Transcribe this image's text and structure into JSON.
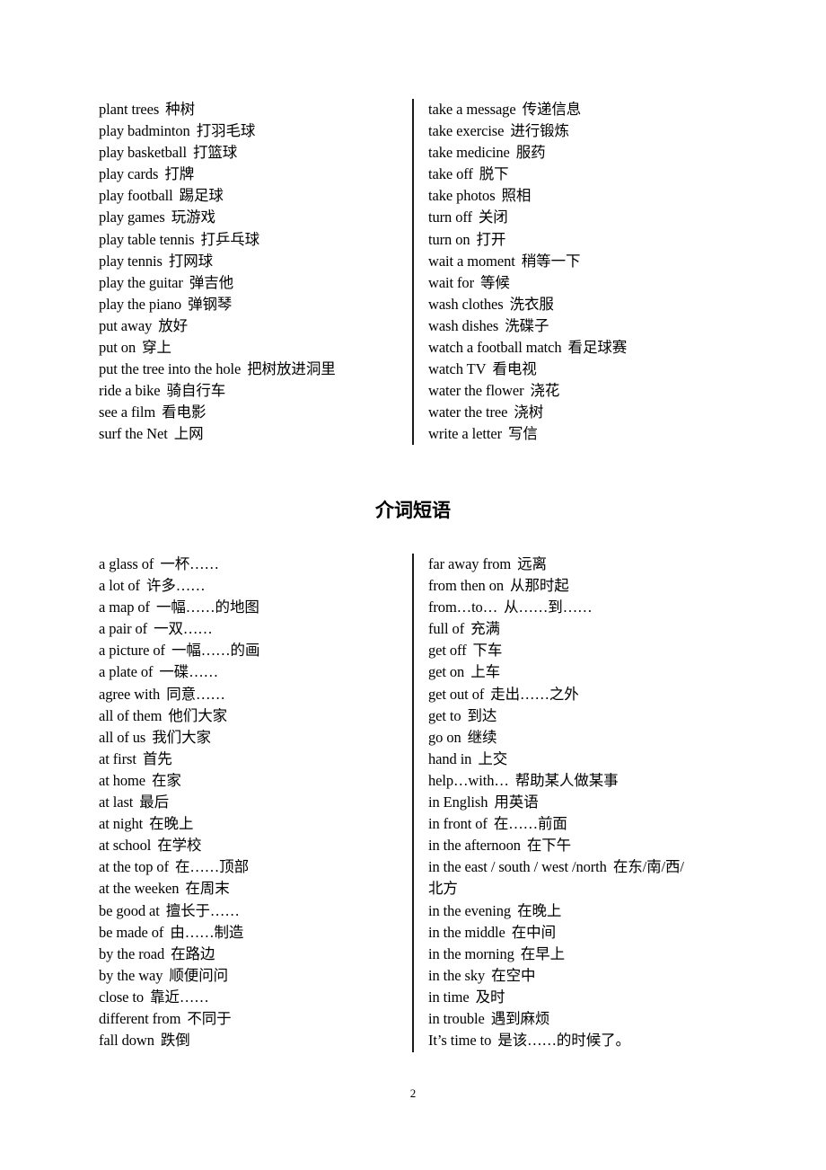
{
  "verb_phrases": {
    "left": [
      {
        "en": "plant trees",
        "zh": "种树"
      },
      {
        "en": "play badminton",
        "zh": "打羽毛球"
      },
      {
        "en": "play basketball",
        "zh": "打篮球"
      },
      {
        "en": "play cards",
        "zh": "打牌"
      },
      {
        "en": "play football",
        "zh": "踢足球"
      },
      {
        "en": "play games",
        "zh": "玩游戏"
      },
      {
        "en": "play table tennis",
        "zh": "打乒乓球"
      },
      {
        "en": "play tennis",
        "zh": "打网球"
      },
      {
        "en": "play the guitar",
        "zh": "弹吉他"
      },
      {
        "en": "play the piano",
        "zh": "弹钢琴"
      },
      {
        "en": "put away",
        "zh": "放好"
      },
      {
        "en": "put on",
        "zh": "穿上"
      },
      {
        "en": "put the tree into the hole",
        "zh": "把树放进洞里"
      },
      {
        "en": "ride a bike",
        "zh": "骑自行车"
      },
      {
        "en": "see a film",
        "zh": "看电影"
      },
      {
        "en": "surf the Net",
        "zh": "上网"
      }
    ],
    "right": [
      {
        "en": "take a message",
        "zh": "传递信息"
      },
      {
        "en": "take exercise",
        "zh": "进行锻炼"
      },
      {
        "en": "take medicine",
        "zh": "服药"
      },
      {
        "en": "take off",
        "zh": "脱下"
      },
      {
        "en": "take photos",
        "zh": "照相"
      },
      {
        "en": "turn off",
        "zh": "关闭"
      },
      {
        "en": "turn on",
        "zh": "打开"
      },
      {
        "en": "wait a moment",
        "zh": "稍等一下"
      },
      {
        "en": "wait for",
        "zh": "等候"
      },
      {
        "en": "wash clothes",
        "zh": "洗衣服"
      },
      {
        "en": "wash dishes",
        "zh": "洗碟子"
      },
      {
        "en": "watch a football match",
        "zh": "看足球赛"
      },
      {
        "en": "watch TV",
        "zh": "看电视"
      },
      {
        "en": "water the flower",
        "zh": "浇花"
      },
      {
        "en": "water the tree",
        "zh": "浇树"
      },
      {
        "en": "write a letter",
        "zh": "写信"
      }
    ]
  },
  "section_heading": "介词短语",
  "prepositional_phrases": {
    "left": [
      {
        "en": "a glass of",
        "zh": "一杯……"
      },
      {
        "en": "a lot of",
        "zh": "许多……"
      },
      {
        "en": "a map of",
        "zh": "一幅……的地图"
      },
      {
        "en": "a pair of",
        "zh": "一双……"
      },
      {
        "en": "a picture of",
        "zh": "一幅……的画"
      },
      {
        "en": "a plate of",
        "zh": "一碟……"
      },
      {
        "en": "agree with",
        "zh": "同意……"
      },
      {
        "en": "all of them",
        "zh": "他们大家"
      },
      {
        "en": "all of us",
        "zh": "我们大家"
      },
      {
        "en": "at first",
        "zh": "首先"
      },
      {
        "en": "at home",
        "zh": "在家"
      },
      {
        "en": "at last",
        "zh": "最后"
      },
      {
        "en": "at night",
        "zh": "在晚上"
      },
      {
        "en": "at school",
        "zh": "在学校"
      },
      {
        "en": "at the top of",
        "zh": "在……顶部"
      },
      {
        "en": "at the weeken",
        "zh": "在周末"
      },
      {
        "en": "be good at",
        "zh": "擅长于……"
      },
      {
        "en": "be made of",
        "zh": "由……制造"
      },
      {
        "en": "by the road",
        "zh": "在路边"
      },
      {
        "en": "by the way",
        "zh": "顺便问问"
      },
      {
        "en": "close to",
        "zh": "靠近……"
      },
      {
        "en": "different from",
        "zh": "不同于"
      },
      {
        "en": "fall down",
        "zh": "跌倒"
      }
    ],
    "right": [
      {
        "en": "far away from",
        "zh": "远离"
      },
      {
        "en": "from then on",
        "zh": "从那时起"
      },
      {
        "en": "from…to…",
        "zh": "从……到……"
      },
      {
        "en": "full of",
        "zh": "充满"
      },
      {
        "en": "get off",
        "zh": "下车"
      },
      {
        "en": "get on",
        "zh": "上车"
      },
      {
        "en": "get out of",
        "zh": "走出……之外"
      },
      {
        "en": "get to",
        "zh": "到达"
      },
      {
        "en": "go on",
        "zh": "继续"
      },
      {
        "en": "hand in",
        "zh": "上交"
      },
      {
        "en": "help…with…",
        "zh": "帮助某人做某事"
      },
      {
        "en": "in English",
        "zh": "用英语"
      },
      {
        "en": "in front of",
        "zh": "在……前面"
      },
      {
        "en": "in the afternoon",
        "zh": "在下午"
      },
      {
        "en": "in the east / south / west /north",
        "zh": "在东/南/西/",
        "zh_wrap": "北方"
      },
      {
        "en": "in the evening",
        "zh": "在晚上"
      },
      {
        "en": "in the middle",
        "zh": "在中间"
      },
      {
        "en": "in the morning",
        "zh": "在早上"
      },
      {
        "en": "in the sky",
        "zh": "在空中"
      },
      {
        "en": "in time",
        "zh": "及时"
      },
      {
        "en": "in trouble",
        "zh": "遇到麻烦"
      },
      {
        "en": "It’s time to",
        "zh": "是该……的时候了。"
      }
    ]
  },
  "page_number": "2"
}
